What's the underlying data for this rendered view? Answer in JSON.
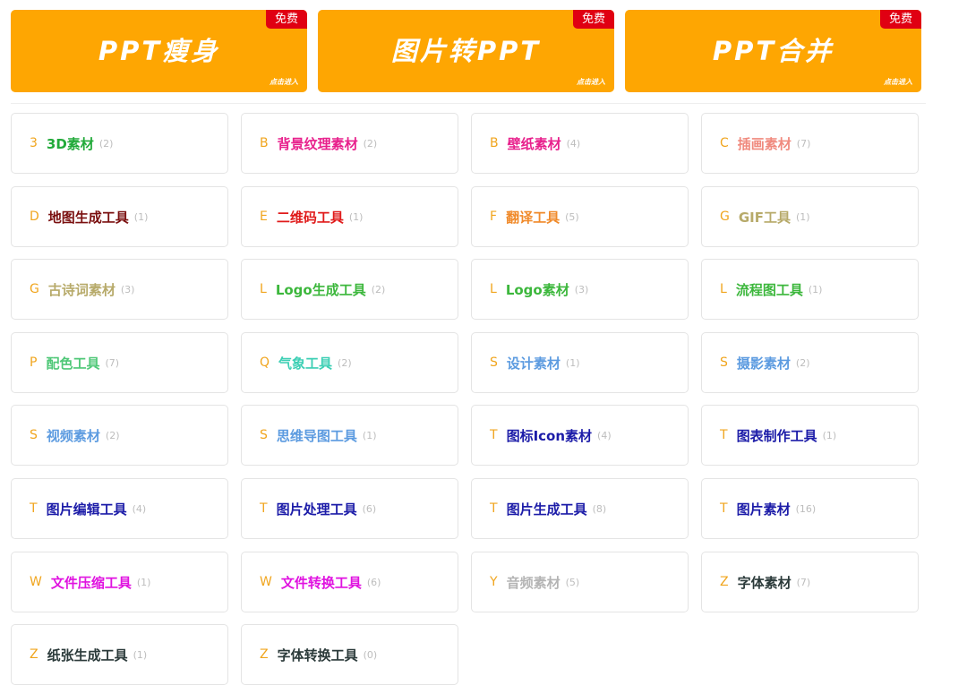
{
  "banners": [
    {
      "title": "PPT瘦身",
      "badge": "免费",
      "enter": "点击进入"
    },
    {
      "title": "图片转PPT",
      "badge": "免费",
      "enter": "点击进入"
    },
    {
      "title": "PPT合并",
      "badge": "免费",
      "enter": "点击进入"
    }
  ],
  "categories": [
    {
      "letter": "3",
      "name": "3D素材",
      "count": "(2)",
      "color": "#22aa3a"
    },
    {
      "letter": "B",
      "name": "背景纹理素材",
      "count": "(2)",
      "color": "#e8208c"
    },
    {
      "letter": "B",
      "name": "壁纸素材",
      "count": "(4)",
      "color": "#e8208c"
    },
    {
      "letter": "C",
      "name": "插画素材",
      "count": "(7)",
      "color": "#f08a7e"
    },
    {
      "letter": "D",
      "name": "地图生成工具",
      "count": "(1)",
      "color": "#7a0f0f"
    },
    {
      "letter": "E",
      "name": "二维码工具",
      "count": "(1)",
      "color": "#e01b1b"
    },
    {
      "letter": "F",
      "name": "翻译工具",
      "count": "(5)",
      "color": "#f08a2a"
    },
    {
      "letter": "G",
      "name": "GIF工具",
      "count": "(1)",
      "color": "#b7aa6a"
    },
    {
      "letter": "G",
      "name": "古诗词素材",
      "count": "(3)",
      "color": "#b7aa6a"
    },
    {
      "letter": "L",
      "name": "Logo生成工具",
      "count": "(2)",
      "color": "#3cb73c"
    },
    {
      "letter": "L",
      "name": "Logo素材",
      "count": "(3)",
      "color": "#3cb73c"
    },
    {
      "letter": "L",
      "name": "流程图工具",
      "count": "(1)",
      "color": "#3cb73c"
    },
    {
      "letter": "P",
      "name": "配色工具",
      "count": "(7)",
      "color": "#50c878"
    },
    {
      "letter": "Q",
      "name": "气象工具",
      "count": "(2)",
      "color": "#3ccfb4"
    },
    {
      "letter": "S",
      "name": "设计素材",
      "count": "(1)",
      "color": "#5c9be0"
    },
    {
      "letter": "S",
      "name": "摄影素材",
      "count": "(2)",
      "color": "#5c9be0"
    },
    {
      "letter": "S",
      "name": "视频素材",
      "count": "(2)",
      "color": "#5c9be0"
    },
    {
      "letter": "S",
      "name": "思维导图工具",
      "count": "(1)",
      "color": "#5c9be0"
    },
    {
      "letter": "T",
      "name": "图标Icon素材",
      "count": "(4)",
      "color": "#1c1ca8"
    },
    {
      "letter": "T",
      "name": "图表制作工具",
      "count": "(1)",
      "color": "#1c1ca8"
    },
    {
      "letter": "T",
      "name": "图片编辑工具",
      "count": "(4)",
      "color": "#1c1ca8"
    },
    {
      "letter": "T",
      "name": "图片处理工具",
      "count": "(6)",
      "color": "#1c1ca8"
    },
    {
      "letter": "T",
      "name": "图片生成工具",
      "count": "(8)",
      "color": "#1c1ca8"
    },
    {
      "letter": "T",
      "name": "图片素材",
      "count": "(16)",
      "color": "#1c1ca8"
    },
    {
      "letter": "W",
      "name": "文件压缩工具",
      "count": "(1)",
      "color": "#e012e0"
    },
    {
      "letter": "W",
      "name": "文件转换工具",
      "count": "(6)",
      "color": "#e012e0"
    },
    {
      "letter": "Y",
      "name": "音频素材",
      "count": "(5)",
      "color": "#b4b4b4"
    },
    {
      "letter": "Z",
      "name": "字体素材",
      "count": "(7)",
      "color": "#2b3a3a"
    },
    {
      "letter": "Z",
      "name": "纸张生成工具",
      "count": "(1)",
      "color": "#2b3a3a"
    },
    {
      "letter": "Z",
      "name": "字体转换工具",
      "count": "(0)",
      "color": "#2b3a3a"
    }
  ],
  "colors": {
    "banner_bg": "#fea602",
    "badge_bg": "#e00012",
    "letter": "#f0a51e",
    "count": "#bdbdbd"
  }
}
